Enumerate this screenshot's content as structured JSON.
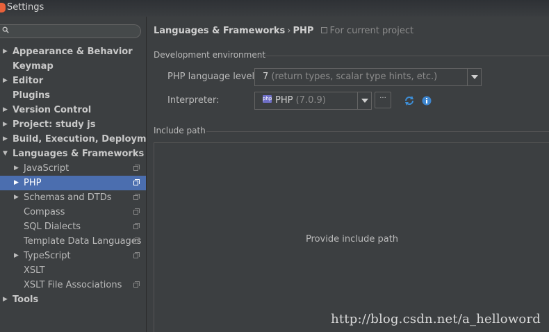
{
  "window": {
    "title": "Settings"
  },
  "search": {
    "value": ""
  },
  "tree": [
    {
      "label": "Appearance & Behavior",
      "level": 0,
      "arrow": "▶",
      "project": false,
      "selected": false
    },
    {
      "label": "Keymap",
      "level": 0,
      "arrow": "",
      "project": false,
      "selected": false
    },
    {
      "label": "Editor",
      "level": 0,
      "arrow": "▶",
      "project": false,
      "selected": false
    },
    {
      "label": "Plugins",
      "level": 0,
      "arrow": "",
      "project": false,
      "selected": false
    },
    {
      "label": "Version Control",
      "level": 0,
      "arrow": "▶",
      "project": false,
      "selected": false
    },
    {
      "label": "Project: study js",
      "level": 0,
      "arrow": "▶",
      "project": false,
      "selected": false
    },
    {
      "label": "Build, Execution, Deployment",
      "level": 0,
      "arrow": "▶",
      "project": false,
      "selected": false
    },
    {
      "label": "Languages & Frameworks",
      "level": 0,
      "arrow": "▼",
      "project": false,
      "selected": false
    },
    {
      "label": "JavaScript",
      "level": 1,
      "arrow": "▶",
      "project": true,
      "selected": false
    },
    {
      "label": "PHP",
      "level": 1,
      "arrow": "▶",
      "project": true,
      "selected": true
    },
    {
      "label": "Schemas and DTDs",
      "level": 1,
      "arrow": "▶",
      "project": true,
      "selected": false
    },
    {
      "label": "Compass",
      "level": 1,
      "arrow": "",
      "project": true,
      "selected": false
    },
    {
      "label": "SQL Dialects",
      "level": 1,
      "arrow": "",
      "project": true,
      "selected": false
    },
    {
      "label": "Template Data Languages",
      "level": 1,
      "arrow": "",
      "project": true,
      "selected": false
    },
    {
      "label": "TypeScript",
      "level": 1,
      "arrow": "▶",
      "project": true,
      "selected": false
    },
    {
      "label": "XSLT",
      "level": 1,
      "arrow": "",
      "project": false,
      "selected": false
    },
    {
      "label": "XSLT File Associations",
      "level": 1,
      "arrow": "",
      "project": true,
      "selected": false
    },
    {
      "label": "Tools",
      "level": 0,
      "arrow": "▶",
      "project": false,
      "selected": false
    }
  ],
  "breadcrumb": {
    "parent": "Languages & Frameworks",
    "separator": "›",
    "current": "PHP",
    "scope": "For current project"
  },
  "dev_env": {
    "title": "Development environment",
    "language_level_label": "PHP language level:",
    "language_level_value": "7",
    "language_level_hint": "(return types, scalar type hints, etc.)",
    "interpreter_label": "Interpreter:",
    "interpreter_badge": "php",
    "interpreter_value": "PHP",
    "interpreter_version": "(7.0.9)",
    "more_label": "···"
  },
  "include_path": {
    "title": "Include path",
    "empty_text": "Provide include path"
  },
  "watermark": "http://blog.csdn.net/a_helloword",
  "colors": {
    "selection": "#4b6eaf",
    "background": "#3c3f41",
    "refresh_icon": "#3d8fd8",
    "info_icon": "#3e86cf"
  }
}
